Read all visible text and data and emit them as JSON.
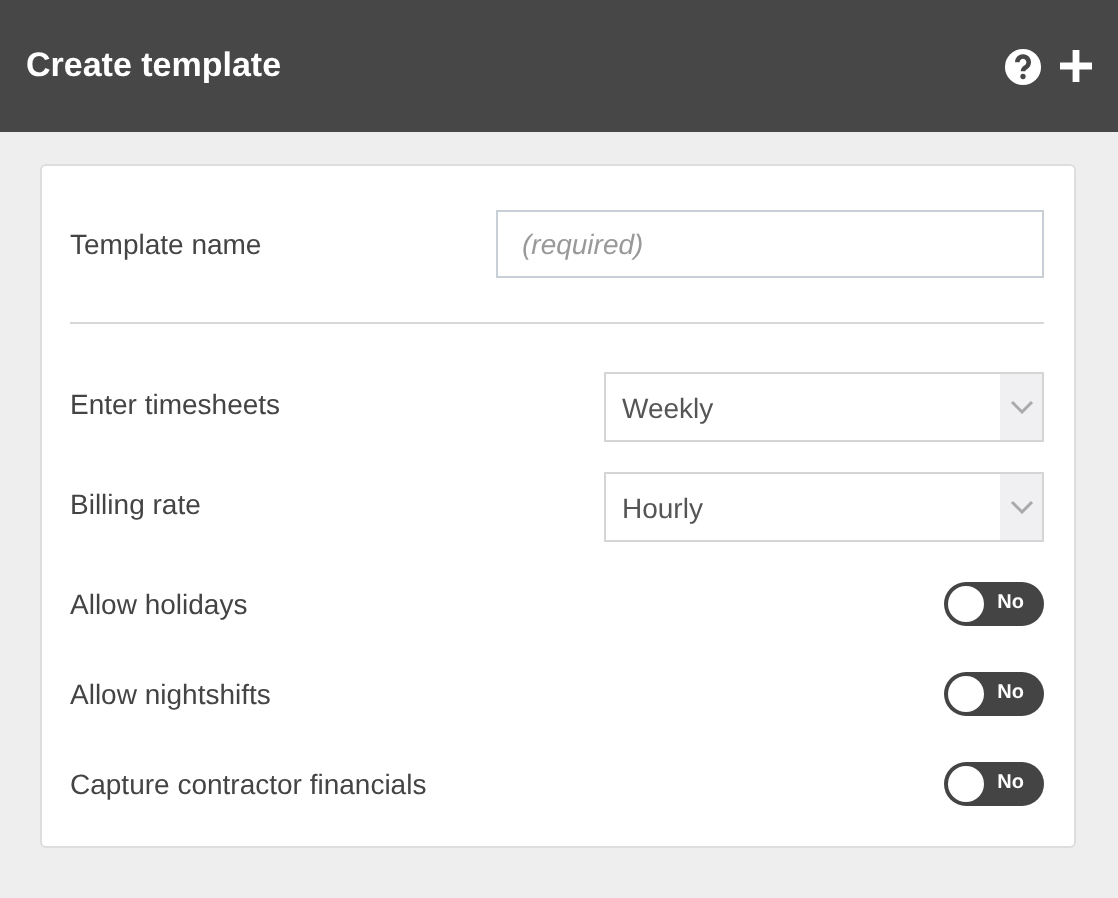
{
  "header": {
    "title": "Create template"
  },
  "name_field": {
    "label": "Template name",
    "placeholder": "(required)"
  },
  "settings": [
    {
      "kind": "select",
      "label": "Enter timesheets",
      "value": "Weekly"
    },
    {
      "kind": "select",
      "label": "Billing rate",
      "value": "Hourly"
    },
    {
      "kind": "toggle",
      "label": "Allow holidays",
      "on": false,
      "text": "No"
    },
    {
      "kind": "toggle",
      "label": "Allow nightshifts",
      "on": false,
      "text": "No"
    },
    {
      "kind": "toggle",
      "label": "Capture contractor financials",
      "on": false,
      "text": "No"
    }
  ]
}
